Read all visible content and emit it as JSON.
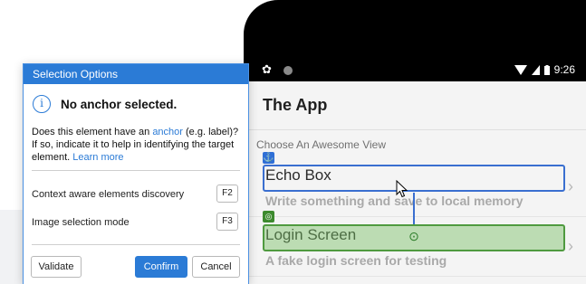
{
  "phone": {
    "status_bar": {
      "gear_icon": "gear-icon",
      "time": "9:26"
    },
    "app_title": "The App",
    "section_header": "Choose An Awesome View",
    "rows": [
      {
        "title": "Echo Box",
        "subtitle": "Write something and save to local memory"
      },
      {
        "title": "Login Screen",
        "subtitle": "A fake login screen for testing"
      }
    ],
    "highlight_colors": {
      "anchor": "#3a6fd0",
      "target": "#4f9a3f"
    }
  },
  "dialog": {
    "title": "Selection Options",
    "info_icon_glyph": "i",
    "info_text": "No anchor selected.",
    "description_part1": "Does this element have an ",
    "description_link": "anchor",
    "description_part2": " (e.g. label)? If so, indicate it to help in identifying the target element. ",
    "learn_more": "Learn more",
    "options": [
      {
        "label": "Context aware elements discovery",
        "key": "F2"
      },
      {
        "label": "Image selection mode",
        "key": "F3"
      }
    ],
    "buttons": {
      "validate": "Validate",
      "confirm": "Confirm",
      "cancel": "Cancel"
    },
    "accent_color": "#2b7bd6"
  }
}
